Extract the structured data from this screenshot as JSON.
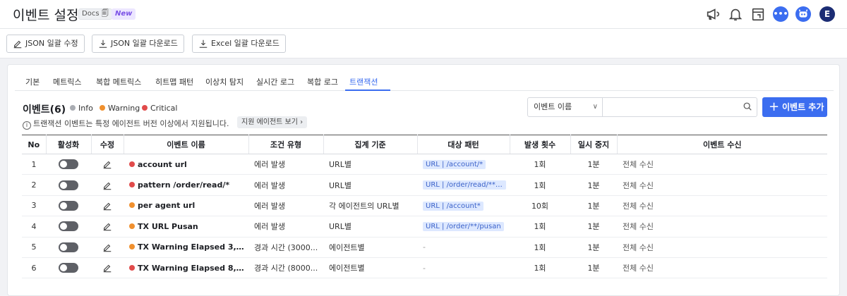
{
  "header": {
    "title": "이벤트 설정",
    "docs_badge": "Docs 🗐",
    "new_badge": "New",
    "avatar_letter": "E",
    "icons": [
      "megaphone-icon",
      "bell-icon",
      "calendar-icon",
      "chat-icon",
      "bot-icon"
    ]
  },
  "toolbar": {
    "json_edit": "JSON 일괄 수정",
    "json_download": "JSON 일괄 다운로드",
    "excel_download": "Excel 일괄 다운로드"
  },
  "tabs": [
    "기본",
    "메트릭스",
    "복합 메트릭스",
    "히트맵 패턴",
    "이상치 탐지",
    "실시간 로그",
    "복합 로그",
    "트랜잭션"
  ],
  "active_tab": "트랜잭션",
  "section": {
    "title": "이벤트(6)",
    "legend": [
      {
        "label": "Info",
        "color": "#a9acb2"
      },
      {
        "label": "Warning",
        "color": "#f0902e"
      },
      {
        "label": "Critical",
        "color": "#e14b4b"
      }
    ],
    "notice": "트랜잭션 이벤트는 특정 에이전트 버전 이상에서 지원됩니다.",
    "agent_link": "지원 에이전트 보기"
  },
  "search": {
    "select_value": "이벤트 이름",
    "placeholder": ""
  },
  "add_button": "이벤트 추가",
  "table": {
    "columns": [
      "No",
      "활성화",
      "수정",
      "이벤트 이름",
      "조건 유형",
      "집계 기준",
      "대상 패턴",
      "발생 횟수",
      "일시 중지",
      "이벤트 수신"
    ],
    "rows": [
      {
        "no": "1",
        "color": "#e14b4b",
        "name": "account url",
        "condition": "에러 발생",
        "aggregate": "URL별",
        "pattern": "URL | /account/*",
        "count": "1회",
        "pause": "1분",
        "receive": "전체 수신"
      },
      {
        "no": "2",
        "color": "#e14b4b",
        "name": "pattern /order/read/*",
        "condition": "에러 발생",
        "aggregate": "URL별",
        "pattern": "URL | /order/read/**/pu...",
        "count": "1회",
        "pause": "1분",
        "receive": "전체 수신"
      },
      {
        "no": "3",
        "color": "#f0902e",
        "name": "per agent url",
        "condition": "에러 발생",
        "aggregate": "각 에이전트의 URL별",
        "pattern": "URL | /account*",
        "count": "10회",
        "pause": "1분",
        "receive": "전체 수신"
      },
      {
        "no": "4",
        "color": "#f0902e",
        "name": "TX URL Pusan",
        "condition": "에러 발생",
        "aggregate": "URL별",
        "pattern": "URL | /order/**/pusan",
        "count": "1회",
        "pause": "1분",
        "receive": "전체 수신"
      },
      {
        "no": "5",
        "color": "#f0902e",
        "name": "TX Warning Elapsed 3,000 ...",
        "condition": "경과 시간 (3000...",
        "aggregate": "에이전트별",
        "pattern": "-",
        "count": "1회",
        "pause": "1분",
        "receive": "전체 수신"
      },
      {
        "no": "6",
        "color": "#e14b4b",
        "name": "TX Warning Elapsed 8,000 ...",
        "condition": "경과 시간 (8000...",
        "aggregate": "에이전트별",
        "pattern": "-",
        "count": "1회",
        "pause": "1분",
        "receive": "전체 수신"
      }
    ]
  }
}
